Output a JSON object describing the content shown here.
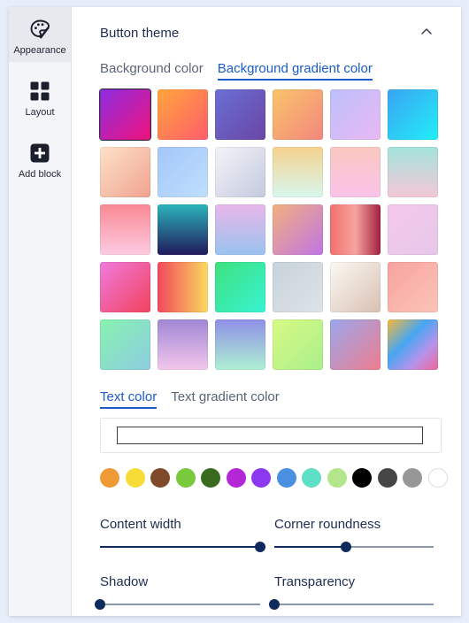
{
  "sidebar": {
    "items": [
      {
        "label": "Appearance",
        "icon": "palette-icon",
        "active": true
      },
      {
        "label": "Layout",
        "icon": "grid-icon",
        "active": false
      },
      {
        "label": "Add block",
        "icon": "plus-square-icon",
        "active": false
      }
    ]
  },
  "panel": {
    "title": "Button theme",
    "background_tabs": [
      {
        "label": "Background color",
        "active": false
      },
      {
        "label": "Background gradient color",
        "active": true
      }
    ],
    "gradients": [
      "linear-gradient(135deg,#8e2de2 0%,#f0127c 100%)",
      "linear-gradient(135deg,#ffa53a 0%,#ff5d6c 100%)",
      "linear-gradient(135deg,#6a6fd6 0%,#6a45a4 100%)",
      "linear-gradient(135deg,#f9c46b 0%,#f3877d 100%)",
      "linear-gradient(135deg,#bcc0fb 0%,#e9b8f2 100%)",
      "linear-gradient(135deg,#3aa3f4 0%,#22eef6 100%)",
      "linear-gradient(135deg,#fde2c8 0%,#f0a28f 100%)",
      "linear-gradient(135deg,#a3c6fb 0%,#bfe0fb 100%)",
      "linear-gradient(135deg,#f3f4f8 0%,#c4c9de 100%)",
      "linear-gradient(180deg,#f6d28f 0%,#d7f7ee 100%)",
      "linear-gradient(180deg,#f9c8c0 0%,#fbc3ea 100%)",
      "linear-gradient(180deg,#a3e3dc 0%,#f4c7d6 100%)",
      "linear-gradient(180deg,#f98993 0%,#fdcbe1 100%)",
      "linear-gradient(180deg,#2bb4bc 0%,#211a5c 100%)",
      "linear-gradient(180deg,#e8b7e9 0%,#9ac3ef 100%)",
      "linear-gradient(135deg,#f2b07e 0%,#c075e4 100%)",
      "linear-gradient(90deg,#f36f6c 0%,#f7a4a0 50%,#a12040 100%)",
      "linear-gradient(135deg,#f4c8ed 0%,#e6c7e9 100%)",
      "linear-gradient(135deg,#ef7bde 0%,#f2425c 100%)",
      "linear-gradient(90deg,#f2475c 0%,#fbd95f 100%)",
      "linear-gradient(135deg,#3ee17e 0%,#38f3d2 100%)",
      "linear-gradient(135deg,#c8d2da 0%,#dde4e8 100%)",
      "linear-gradient(135deg,#fbf9f4 0%,#d9c0b2 100%)",
      "linear-gradient(135deg,#f7a29f 0%,#fbc5b6 100%)",
      "linear-gradient(135deg,#86f3ae 0%,#8ecce2 100%)",
      "linear-gradient(180deg,#a086d5 0%,#f3c7eb 100%)",
      "linear-gradient(180deg,#8e8fe6 0%,#aef0d2 100%)",
      "linear-gradient(135deg,#d8fa84 0%,#a9ee8b 100%)",
      "linear-gradient(135deg,#9aa7ee 0%,#ee7d8d 100%)",
      "linear-gradient(135deg,#f7b93b 0%,#47a6f2 40%,#b992eb 70%,#f2659a 100%)"
    ],
    "text_tabs": [
      {
        "label": "Text color",
        "active": true
      },
      {
        "label": "Text gradient color",
        "active": false
      }
    ],
    "text_color_value": "",
    "text_colors": [
      "#f09a35",
      "#f7dc38",
      "#7e4a2a",
      "#79c93c",
      "#3a6a1d",
      "#b427d6",
      "#8b38f0",
      "#4a8fe0",
      "#5fe0c6",
      "#b3e58a",
      "#000000",
      "#464646",
      "#979797",
      "#ffffff"
    ],
    "sliders": [
      {
        "label": "Content width",
        "value": 1.0
      },
      {
        "label": "Corner roundness",
        "value": 0.45
      },
      {
        "label": "Shadow",
        "value": 0.0
      },
      {
        "label": "Transparency",
        "value": 0.0
      }
    ]
  },
  "colors": {
    "accent": "#1b5cc8",
    "slider": "#0f2a5c"
  }
}
